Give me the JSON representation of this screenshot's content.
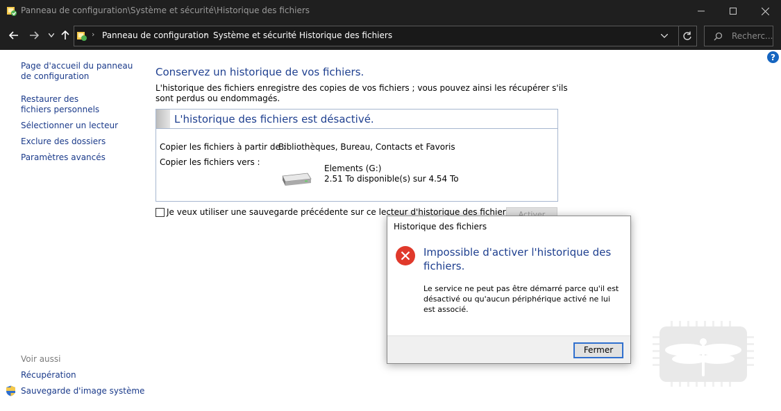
{
  "window": {
    "title": "Panneau de configuration\\Système et sécurité\\Historique des fichiers"
  },
  "navigation": {
    "breadcrumb": [
      "Panneau de configuration",
      "Système et sécurité",
      "Historique des fichiers"
    ],
    "search_placeholder": "Recherc..."
  },
  "sidebar": {
    "links": [
      "Page d'accueil du panneau de configuration",
      "Restaurer des fichiers personnels",
      "Sélectionner un lecteur",
      "Exclure des dossiers",
      "Paramètres avancés"
    ],
    "see_also_title": "Voir aussi",
    "see_also": [
      "Récupération",
      "Sauvegarde d'image système"
    ]
  },
  "main": {
    "title": "Conservez un historique de vos fichiers.",
    "description": "L'historique des fichiers enregistre des copies de vos fichiers ; vous pouvez ainsi les récupérer s'ils sont perdus ou endommagés.",
    "status_title": "L'historique des fichiers est désactivé.",
    "copy_from_label": "Copier les fichiers à partir de :",
    "copy_from_value": "Bibliothèques, Bureau, Contacts et Favoris",
    "copy_to_label": "Copier les fichiers vers :",
    "drive_name": "Elements (G:)",
    "drive_space": "2.51 To disponible(s) sur 4.54 To",
    "checkbox_label": "Je veux utiliser une sauvegarde précédente sur ce lecteur d'historique des fichiers.",
    "checkbox_checked": false,
    "activate_button": "Activer"
  },
  "dialog": {
    "title": "Historique des fichiers",
    "heading": "Impossible d'activer l'historique des fichiers.",
    "message": "Le service ne peut pas être démarré parce qu'il est désactivé ou qu'aucun périphérique activé ne lui est associé.",
    "close_button": "Fermer"
  },
  "colors": {
    "title_bar": "#1f1f1f",
    "link": "#1a3a8a",
    "heading": "#1e3f8f",
    "error_red": "#e0392b",
    "button_focus": "#2f6fce"
  },
  "icons": [
    "control-panel-icon",
    "back-icon",
    "forward-icon",
    "up-icon",
    "refresh-icon",
    "search-icon",
    "help-icon",
    "drive-icon",
    "error-icon",
    "shield-icon"
  ]
}
